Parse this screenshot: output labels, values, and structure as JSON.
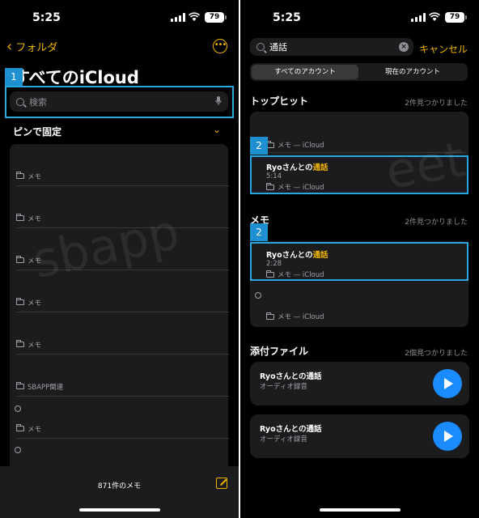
{
  "status": {
    "time": "5:25",
    "battery": "79"
  },
  "left": {
    "back_label": "フォルダ",
    "title": "すべてのiCloud",
    "search_placeholder": "検索",
    "callout": "1",
    "pinned_label": "ピンで固定",
    "rows": [
      "メモ",
      "メモ",
      "メモ",
      "メモ",
      "メモ",
      "SBAPP関連",
      "メモ"
    ],
    "note_count": "871件のメモ",
    "watermark": "sbapp"
  },
  "right": {
    "search_value": "通話",
    "cancel_label": "キャンセル",
    "segments": [
      "すべてのアカウント",
      "現在のアカウント"
    ],
    "top_hits": {
      "header": "トップヒット",
      "count": "2件見つかりました",
      "first_folder": "メモ — iCloud",
      "callout": "2",
      "result": {
        "title_prefix": "Ryoさんとの",
        "title_highlight": "通話",
        "time": "5:14",
        "folder": "メモ — iCloud"
      }
    },
    "memo": {
      "header": "メモ",
      "count": "2件見つかりました",
      "callout": "2",
      "result": {
        "title_prefix": "Ryoさんとの",
        "title_highlight": "通話",
        "time": "2:28",
        "folder": "メモ — iCloud"
      },
      "second_folder": "メモ — iCloud"
    },
    "attachments": {
      "header": "添付ファイル",
      "count": "2個見つかりました",
      "items": [
        {
          "title": "Ryoさんとの通話",
          "subtitle": "オーディオ録音"
        },
        {
          "title": "Ryoさんとの通話",
          "subtitle": "オーディオ録音"
        }
      ]
    },
    "watermark": "eet"
  },
  "colors": {
    "accent": "#f0b400",
    "highlight_border": "#2aa7e0",
    "play": "#1a8cff"
  }
}
